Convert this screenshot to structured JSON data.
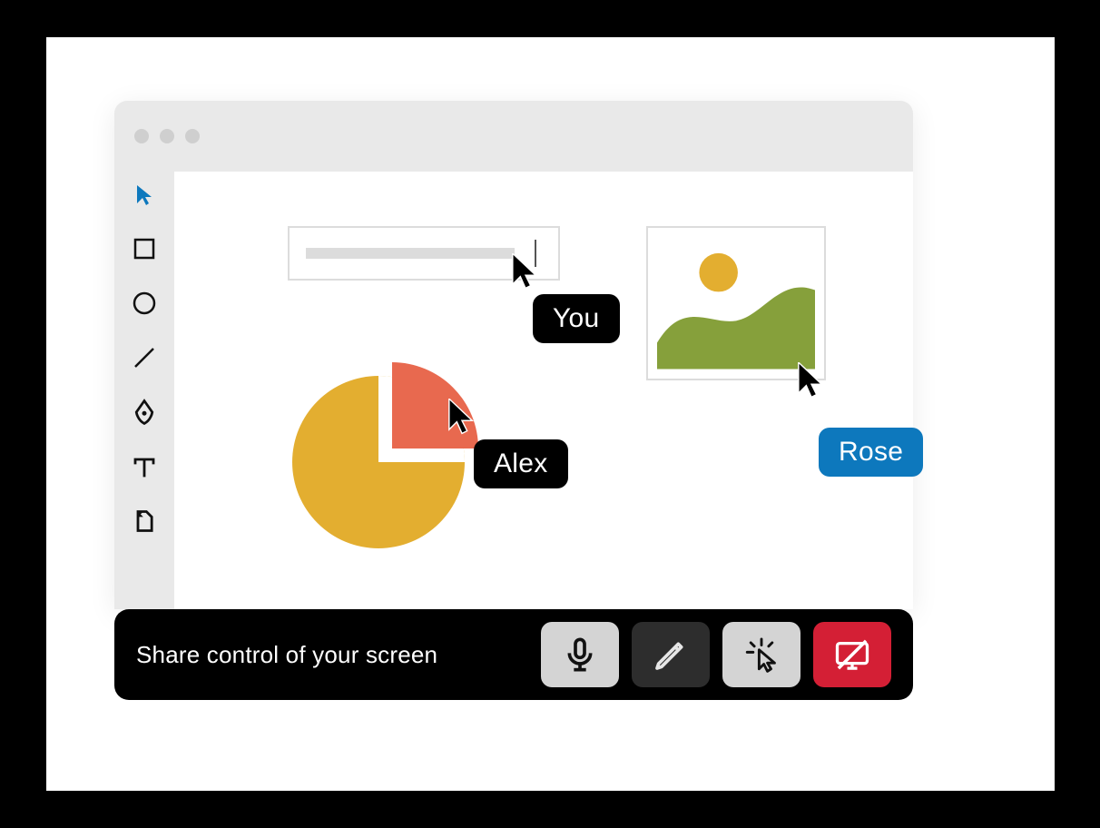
{
  "controlbar": {
    "caption": "Share control of your screen"
  },
  "cursors": {
    "you": "You",
    "alex": "Alex",
    "rose": "Rose"
  },
  "colors": {
    "accent_blue": "#0d78bd",
    "gold": "#e3ae30",
    "red_slice": "#e8694f",
    "green": "#86a03b",
    "danger": "#d41f35"
  },
  "tools": [
    "select",
    "rectangle",
    "circle",
    "line",
    "pen",
    "text",
    "page"
  ]
}
